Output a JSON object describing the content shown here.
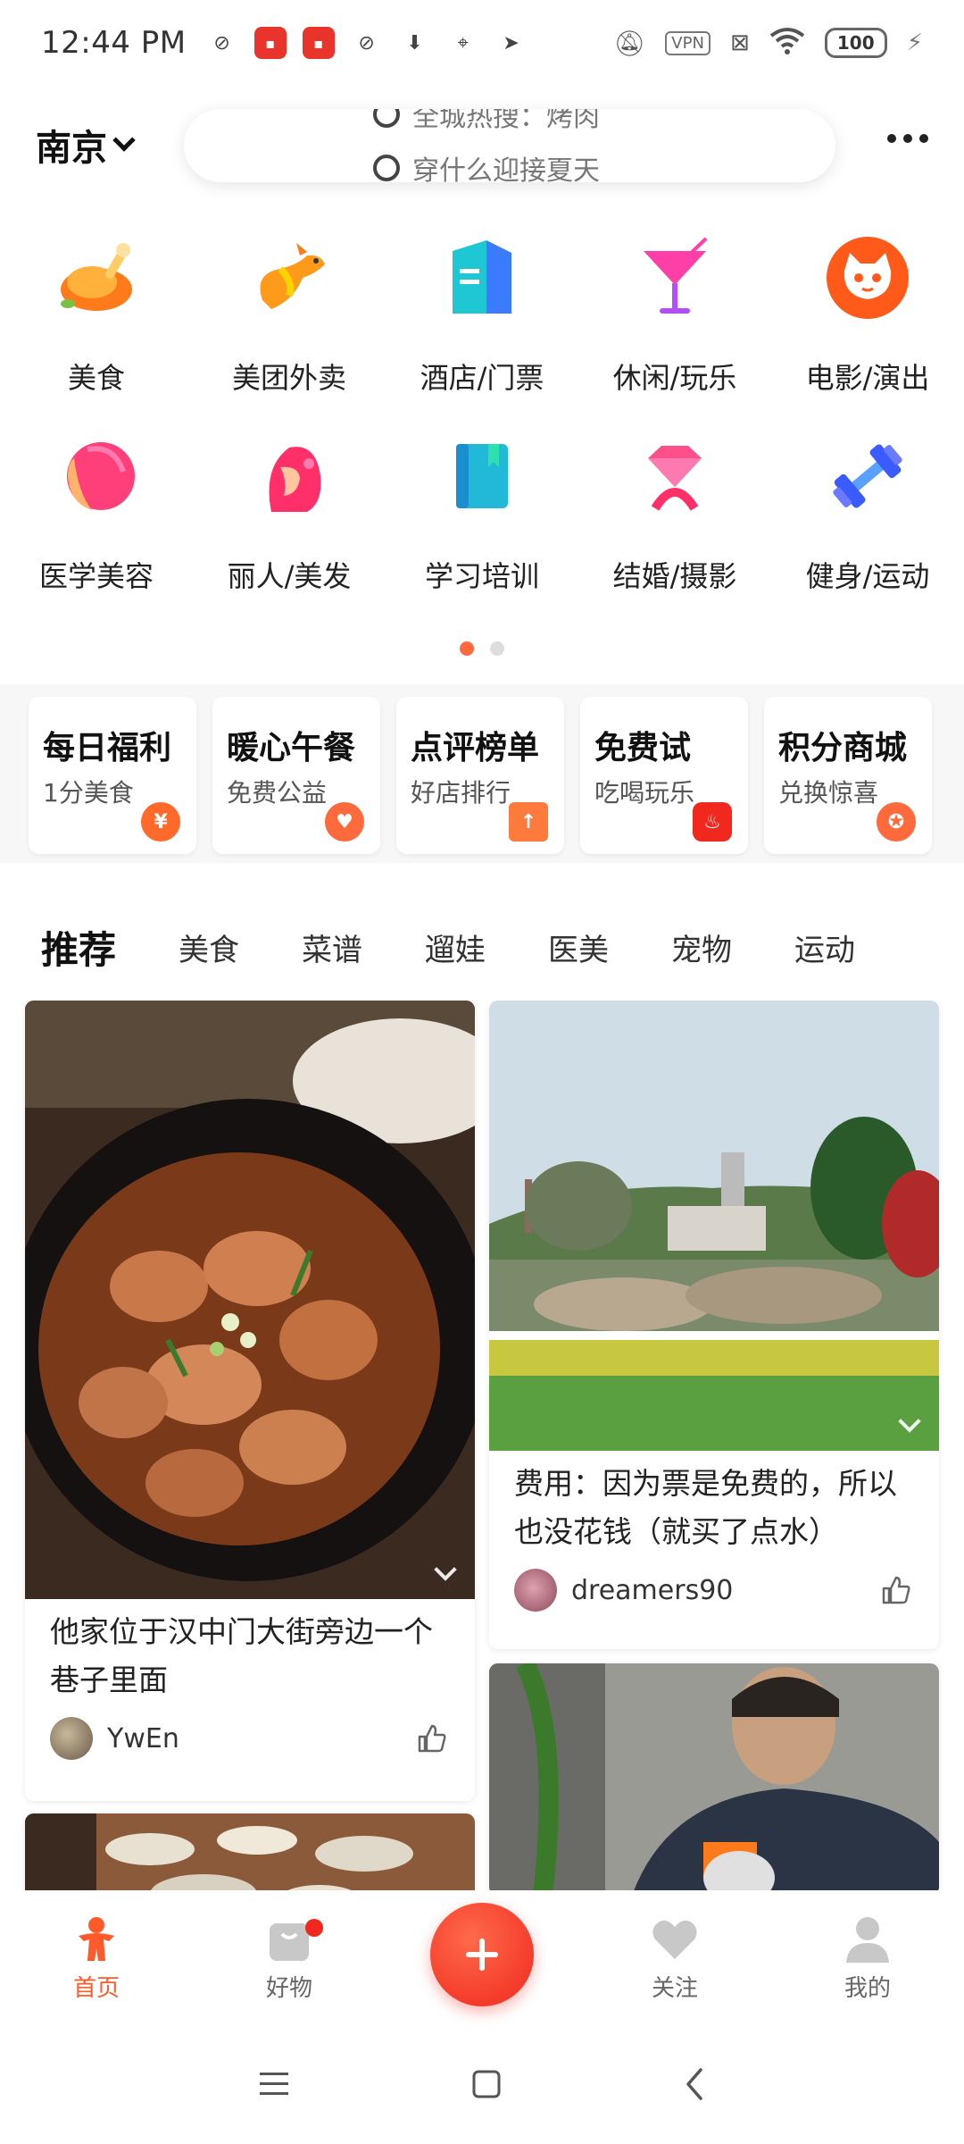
{
  "status_bar": {
    "time": "12:44 PM",
    "vpn_label": "VPN",
    "battery": "100"
  },
  "header": {
    "city": "南京",
    "search_suggestions": [
      "全城热搜：烤肉",
      "穿什么迎接夏天"
    ]
  },
  "categories": {
    "row1": [
      {
        "label": "美食",
        "icon": "roast-chicken-icon"
      },
      {
        "label": "美团外卖",
        "icon": "kangaroo-icon"
      },
      {
        "label": "酒店/门票",
        "icon": "hotel-building-icon"
      },
      {
        "label": "休闲/玩乐",
        "icon": "cocktail-icon"
      },
      {
        "label": "电影/演出",
        "icon": "cat-face-icon"
      }
    ],
    "row2": [
      {
        "label": "医学美容",
        "icon": "face-profile-icon"
      },
      {
        "label": "丽人/美发",
        "icon": "hair-profile-icon"
      },
      {
        "label": "学习培训",
        "icon": "book-icon"
      },
      {
        "label": "结婚/摄影",
        "icon": "diamond-ring-icon"
      },
      {
        "label": "健身/运动",
        "icon": "dumbbell-icon"
      }
    ]
  },
  "features": [
    {
      "title": "每日福利",
      "subtitle": "1分美食",
      "icon": "money-bag-icon",
      "color": "#ff6a2a"
    },
    {
      "title": "暖心午餐",
      "subtitle": "免费公益",
      "icon": "heart-hand-icon",
      "color": "#ff6a3d"
    },
    {
      "title": "点评榜单",
      "subtitle": "好店排行",
      "icon": "ranking-icon",
      "color": "#ff7a3d"
    },
    {
      "title": "免费试",
      "subtitle": "吃喝玩乐",
      "icon": "hotpot-icon",
      "color": "#f0281e"
    },
    {
      "title": "积分商城",
      "subtitle": "兑换惊喜",
      "icon": "points-icon",
      "color": "#ff6a3d"
    }
  ],
  "tabs": [
    "推荐",
    "美食",
    "菜谱",
    "遛娃",
    "医美",
    "宠物",
    "运动"
  ],
  "feed": {
    "left": [
      {
        "title": "他家位于汉中门大街旁边一个巷子里面",
        "user": "YwEn"
      }
    ],
    "right": [
      {
        "title": "费用：因为票是免费的，所以也没花钱（就买了点水）",
        "user": "dreamers90"
      }
    ]
  },
  "bottom_nav": [
    {
      "label": "首页",
      "icon": "home-person-icon",
      "active": true
    },
    {
      "label": "好物",
      "icon": "shopping-bag-icon",
      "active": false
    },
    {
      "label": "",
      "icon": "plus-icon",
      "active": false
    },
    {
      "label": "关注",
      "icon": "heart-icon",
      "active": false
    },
    {
      "label": "我的",
      "icon": "profile-icon",
      "active": false
    }
  ],
  "colors": {
    "brand": "#ff5a2a",
    "accent_red": "#f0281e"
  }
}
